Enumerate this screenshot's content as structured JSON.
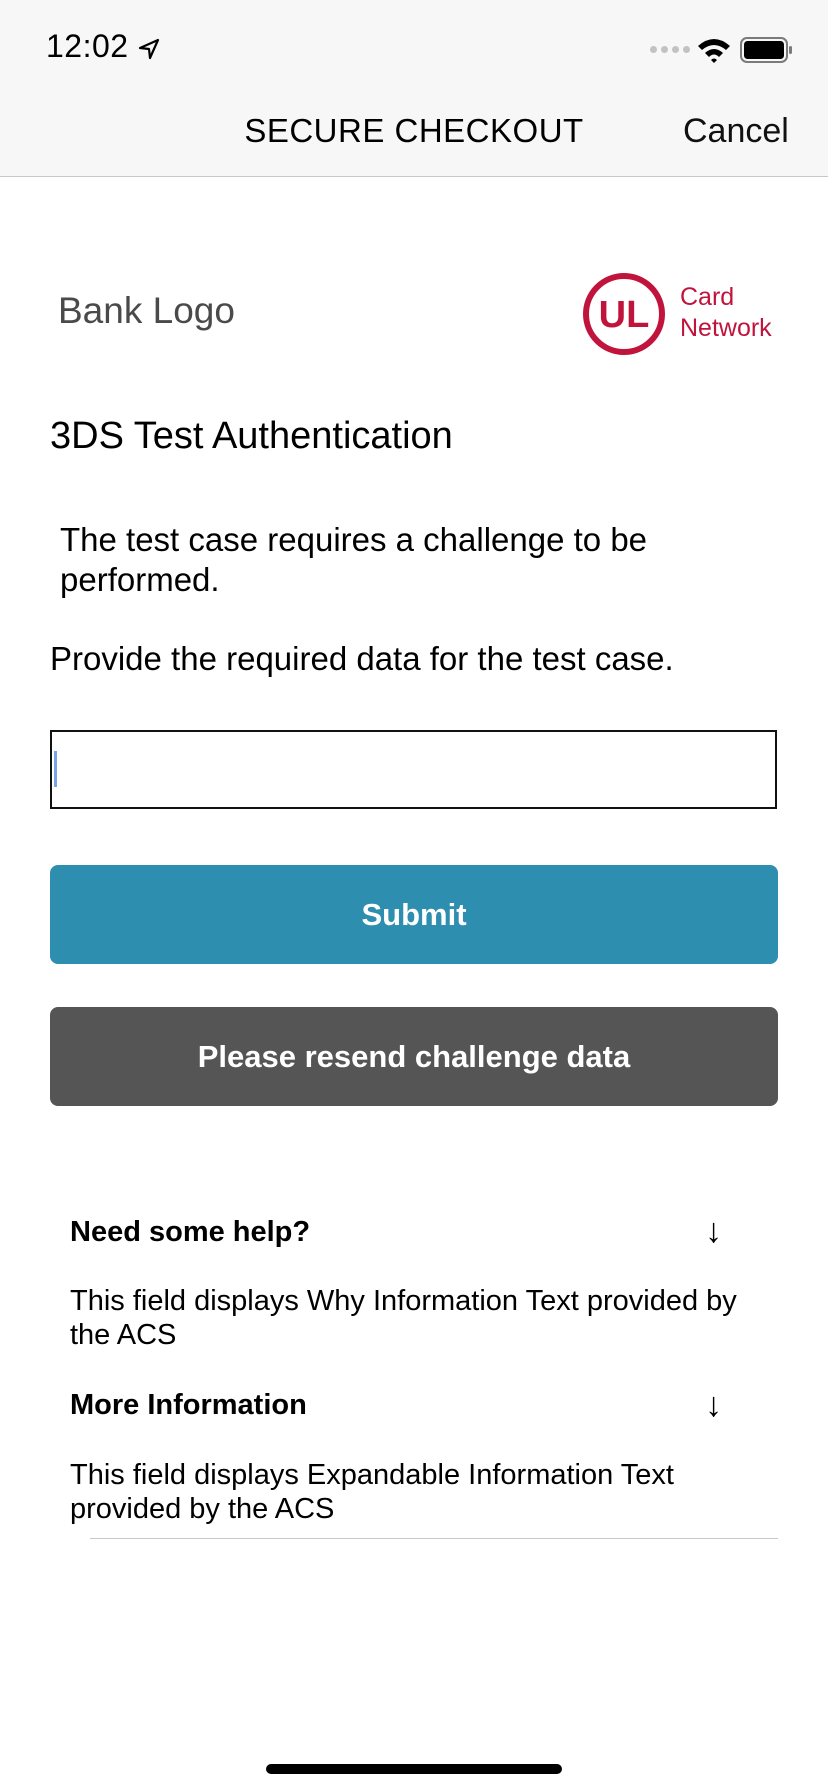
{
  "status_bar": {
    "time": "12:02"
  },
  "nav": {
    "title": "SECURE CHECKOUT",
    "cancel": "Cancel"
  },
  "branding": {
    "bank_logo": "Bank Logo",
    "ul_mark": "UL",
    "card_network_line1": "Card",
    "card_network_line2": "Network"
  },
  "challenge": {
    "heading": "3DS Test Authentication",
    "info_text": "The test case requires a challenge to be performed.",
    "label": "Provide the required data for the test case.",
    "input_value": "",
    "submit_label": "Submit",
    "resend_label": "Please resend challenge data"
  },
  "help": {
    "why_title": "Need some help?",
    "why_text": "This field displays Why Information Text provided by the ACS",
    "more_title": "More Information",
    "more_text": "This field displays Expandable Information Text provided by the ACS",
    "arrow": "↓"
  },
  "colors": {
    "submit": "#2d8eb0",
    "resend": "#555555",
    "ul_red": "#c0143c"
  },
  "icons": [
    "location-arrow-icon",
    "wifi-icon",
    "battery-icon",
    "arrow-down-icon"
  ]
}
